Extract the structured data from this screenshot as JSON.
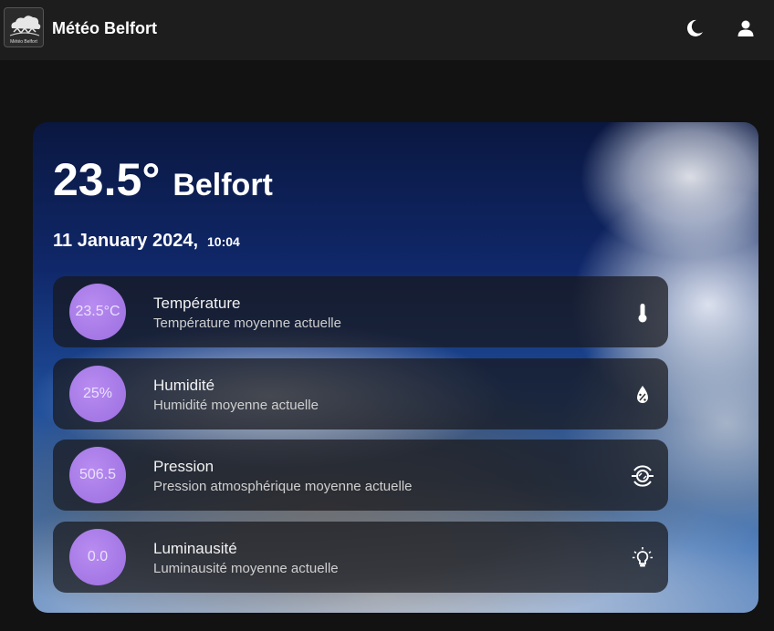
{
  "header": {
    "title": "Météo Belfort",
    "logo_caption": "Météo Belfort",
    "icons": [
      "moon-icon",
      "user-icon"
    ]
  },
  "weather": {
    "temperature_display": "23.5°",
    "city": "Belfort",
    "date": "11 January 2024,",
    "time": "10:04"
  },
  "metrics": [
    {
      "value": "23.5°C",
      "title": "Température",
      "subtitle": "Température moyenne actuelle",
      "icon": "thermometer-icon"
    },
    {
      "value": "25%",
      "title": "Humidité",
      "subtitle": "Humidité moyenne actuelle",
      "icon": "droplet-percent-icon"
    },
    {
      "value": "506.5",
      "title": "Pression",
      "subtitle": "Pression atmosphérique moyenne actuelle",
      "icon": "pressure-icon"
    },
    {
      "value": "0.0",
      "title": "Luminausité",
      "subtitle": "Luminausité moyenne actuelle",
      "icon": "lightbulb-icon"
    }
  ],
  "colors": {
    "topbar": "#1d1d1d",
    "background": "#121212",
    "bubble": "#a77ce8"
  }
}
